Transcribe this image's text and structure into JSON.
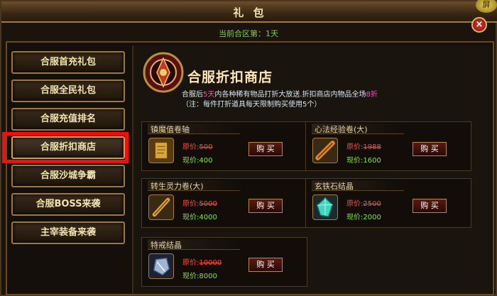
{
  "window": {
    "title": "礼 包",
    "corner_button": "屏",
    "close": "×"
  },
  "zone_text": "当前合区第：1天",
  "sidebar": {
    "items": [
      {
        "label": "合服首充礼包"
      },
      {
        "label": "合服全民礼包"
      },
      {
        "label": "合服充值排名"
      },
      {
        "label": "合服折扣商店",
        "active": true
      },
      {
        "label": "合服沙城争霸"
      },
      {
        "label": "合服BOSS来袭"
      },
      {
        "label": "主宰装备来袭"
      }
    ]
  },
  "shop": {
    "title": "合服折扣商店",
    "desc_a": "合服后",
    "desc_days": "5天",
    "desc_b": "内各种稀有物品打折大放送.折扣商店内物品全场",
    "desc_discount": "8折",
    "desc_note": "（注：每件打折道具每天限制购买使用5个）"
  },
  "labels": {
    "orig": "原价:",
    "now": "现价:",
    "buy": "购 买"
  },
  "items": [
    {
      "name": "镇魔值卷轴",
      "orig": "500",
      "now": "400",
      "icon": "scroll-icon"
    },
    {
      "name": "心法经验卷(大)",
      "orig": "1988",
      "now": "1600",
      "icon": "book-roll-icon"
    },
    {
      "name": "转生灵力卷(大)",
      "orig": "5000",
      "now": "4000",
      "icon": "roll-icon"
    },
    {
      "name": "玄铁石结晶",
      "orig": "2500",
      "now": "2000",
      "icon": "crystal-icon"
    },
    {
      "name": "特戒结晶",
      "orig": "10000",
      "now": "8000",
      "icon": "gem-icon"
    }
  ]
}
